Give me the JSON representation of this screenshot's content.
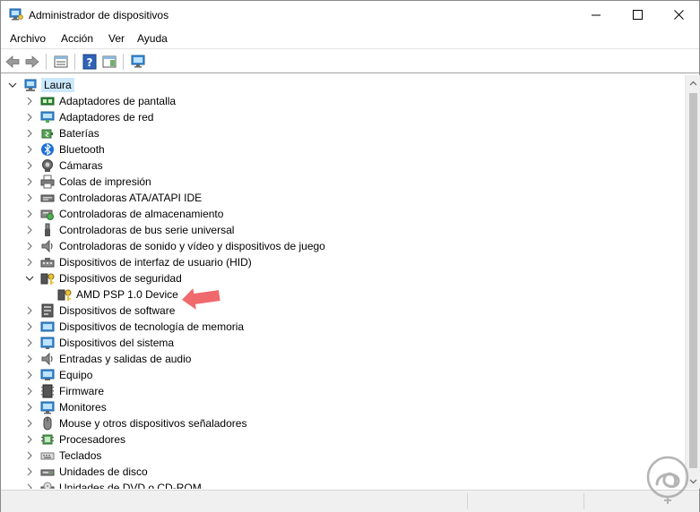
{
  "window": {
    "title": "Administrador de dispositivos"
  },
  "menu": {
    "items": [
      "Archivo",
      "Acción",
      "Ver",
      "Ayuda"
    ]
  },
  "tree": {
    "root": "Laura",
    "items": [
      {
        "label": "Adaptadores de pantalla",
        "icon": "display-adapter-icon",
        "expanded": false
      },
      {
        "label": "Adaptadores de red",
        "icon": "network-adapter-icon",
        "expanded": false
      },
      {
        "label": "Baterías",
        "icon": "battery-icon",
        "expanded": false
      },
      {
        "label": "Bluetooth",
        "icon": "bluetooth-icon",
        "expanded": false
      },
      {
        "label": "Cámaras",
        "icon": "camera-icon",
        "expanded": false
      },
      {
        "label": "Colas de impresión",
        "icon": "printer-icon",
        "expanded": false
      },
      {
        "label": "Controladoras ATA/ATAPI IDE",
        "icon": "ide-controller-icon",
        "expanded": false
      },
      {
        "label": "Controladoras de almacenamiento",
        "icon": "storage-controller-icon",
        "expanded": false
      },
      {
        "label": "Controladoras de bus serie universal",
        "icon": "usb-icon",
        "expanded": false
      },
      {
        "label": "Controladoras de sonido y vídeo y dispositivos de juego",
        "icon": "sound-icon",
        "expanded": false
      },
      {
        "label": "Dispositivos de interfaz de usuario (HID)",
        "icon": "hid-icon",
        "expanded": false
      },
      {
        "label": "Dispositivos de seguridad",
        "icon": "security-device-icon",
        "expanded": true,
        "children": [
          "AMD PSP 1.0 Device"
        ]
      },
      {
        "label": "Dispositivos de software",
        "icon": "software-device-icon",
        "expanded": false
      },
      {
        "label": "Dispositivos de tecnología de memoria",
        "icon": "memory-tech-icon",
        "expanded": false
      },
      {
        "label": "Dispositivos del sistema",
        "icon": "system-device-icon",
        "expanded": false
      },
      {
        "label": "Entradas y salidas de audio",
        "icon": "audio-io-icon",
        "expanded": false
      },
      {
        "label": "Equipo",
        "icon": "computer-icon",
        "expanded": false
      },
      {
        "label": "Firmware",
        "icon": "firmware-icon",
        "expanded": false
      },
      {
        "label": "Monitores",
        "icon": "monitor-icon",
        "expanded": false
      },
      {
        "label": "Mouse y otros dispositivos señaladores",
        "icon": "mouse-icon",
        "expanded": false
      },
      {
        "label": "Procesadores",
        "icon": "processor-icon",
        "expanded": false
      },
      {
        "label": "Teclados",
        "icon": "keyboard-icon",
        "expanded": false
      },
      {
        "label": "Unidades de disco",
        "icon": "disk-drive-icon",
        "expanded": false
      },
      {
        "label": "Unidades de DVD o CD-ROM",
        "icon": "dvd-drive-icon",
        "expanded": false
      }
    ]
  },
  "colors": {
    "selection": "#cce8ff",
    "annotation_arrow": "#f0696c",
    "watermark": "#a8a8a8"
  }
}
